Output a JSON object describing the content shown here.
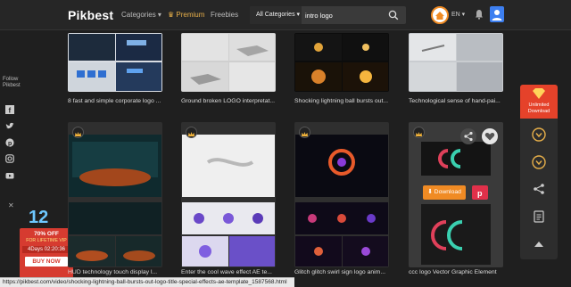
{
  "header": {
    "logo": "Pikbest",
    "nav": {
      "categories": "Categories ▾",
      "premium": "♛ Premium",
      "freebies": "Freebies"
    },
    "search": {
      "category": "All Categories ▾",
      "query": "intro logo"
    },
    "lang": "EN ▾"
  },
  "follow": {
    "label": "Follow Pikbest"
  },
  "promo": {
    "number": "12",
    "line1": "70% OFF",
    "line2": "FOR LIFETIME VIP",
    "timer": "4Days 02:20:36",
    "button": "BUY NOW"
  },
  "cards_top": [
    {
      "caption": "8 fast and simple corporate logo ..."
    },
    {
      "caption": "Ground broken LOGO interpretat..."
    },
    {
      "caption": "Shocking lightning ball bursts out..."
    },
    {
      "caption": "Technological sense of hand-pai..."
    }
  ],
  "cards_bottom": [
    {
      "caption": "HUD technology touch display l..."
    },
    {
      "caption": "Enter the cool wave effect AE te..."
    },
    {
      "caption": "Glitch glitch swirl sign logo anim..."
    },
    {
      "caption": "ccc logo Vector Graphic Element"
    }
  ],
  "hover_card": {
    "download": "⬇ Download"
  },
  "right_panel": {
    "unlimited": "Unlimited Download"
  },
  "status_url": "https://pikbest.com/video/shocking-lightning-ball-bursts-out-logo-title-special-effects-ae-template_1587568.html",
  "colors": {
    "accent": "#f08b24",
    "premium": "#e8b04a",
    "promo_red": "#d63b30",
    "avatar": "#3d7ff0"
  }
}
